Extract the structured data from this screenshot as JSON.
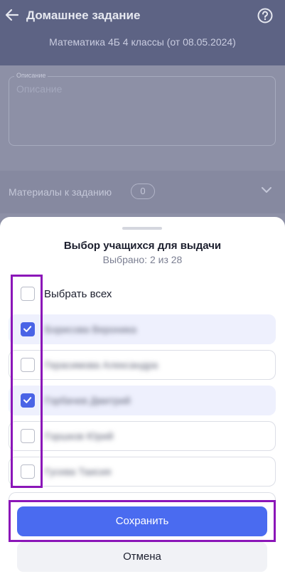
{
  "header": {
    "title": "Домашнее задание",
    "subtitle": "Математика 4Б 4 классы (от 08.05.2024)"
  },
  "form": {
    "description_label": "Описание",
    "description_placeholder": "Описание",
    "materials_label": "Материалы к заданию",
    "materials_count": "0"
  },
  "sheet": {
    "title": "Выбор учащихся для выдачи",
    "selected_text": "Выбрано: 2 из 28",
    "select_all_label": "Выбрать всех",
    "select_all_checked": false,
    "students": [
      {
        "name": "Борисова Вероника",
        "checked": true
      },
      {
        "name": "Герасимова Александра",
        "checked": false
      },
      {
        "name": "Горбачев Дмитрий",
        "checked": true
      },
      {
        "name": "Горшков Юрий",
        "checked": false
      },
      {
        "name": "Гусева Таисия",
        "checked": false
      }
    ],
    "save_label": "Сохранить",
    "cancel_label": "Отмена"
  },
  "colors": {
    "accent": "#4a6bf0",
    "highlight": "#8b16b8"
  }
}
